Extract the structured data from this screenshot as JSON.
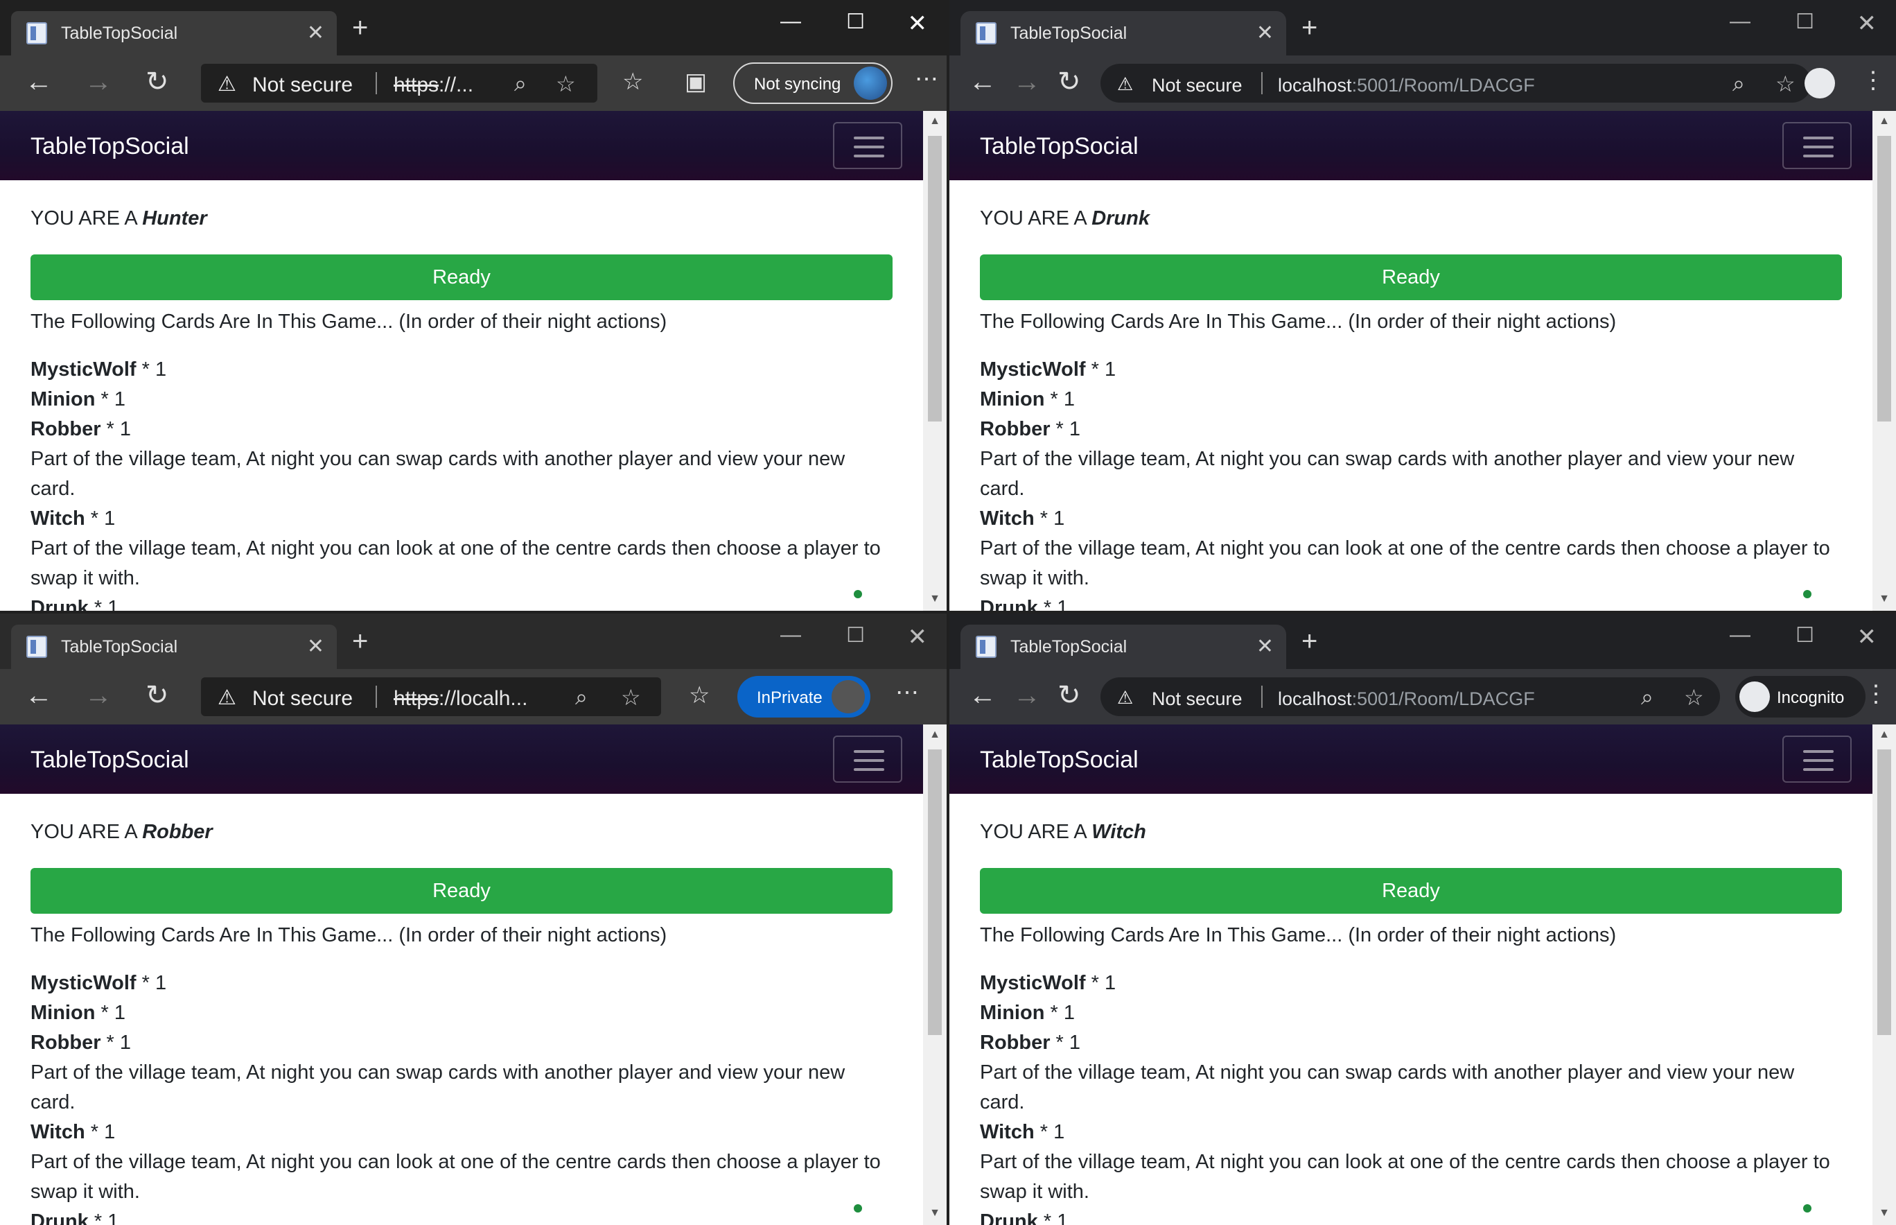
{
  "tab_title": "TableTopSocial",
  "windows": {
    "edge_normal": {
      "not_secure": "Not secure",
      "url_scheme": "https",
      "url_rest": "://...",
      "profile_label": "Not syncing",
      "role": "Hunter"
    },
    "chrome_normal": {
      "not_secure": "Not secure",
      "url_host": "localhost",
      "url_path": ":5001/Room/LDACGF",
      "role": "Drunk"
    },
    "edge_inprivate": {
      "not_secure": "Not secure",
      "url_scheme": "https",
      "url_rest": "://localh...",
      "profile_label": "InPrivate",
      "role": "Robber"
    },
    "chrome_incognito": {
      "not_secure": "Not secure",
      "url_host": "localhost",
      "url_path": ":5001/Room/LDACGF",
      "profile_label": "Incognito",
      "role": "Witch"
    }
  },
  "page": {
    "brand": "TableTopSocial",
    "you_are": "YOU ARE A",
    "ready": "Ready",
    "intro": "The Following Cards Are In This Game... (In order of their night actions)",
    "cards": [
      {
        "name": "MysticWolf",
        "count": " * 1",
        "desc": ""
      },
      {
        "name": "Minion",
        "count": " * 1",
        "desc": ""
      },
      {
        "name": "Robber",
        "count": " * 1",
        "desc": "Part of the village team, At night you can swap cards with another player and view your new card."
      },
      {
        "name": "Witch",
        "count": " * 1",
        "desc": "Part of the village team, At night you can look at one of the centre cards then choose a player to swap it with."
      },
      {
        "name": "Drunk",
        "count": " * 1",
        "desc": ""
      }
    ]
  },
  "colors": {
    "ready_green": "#28a745",
    "navbar_dark": "#1a0f2e",
    "inprivate_blue": "#0a64c8"
  }
}
